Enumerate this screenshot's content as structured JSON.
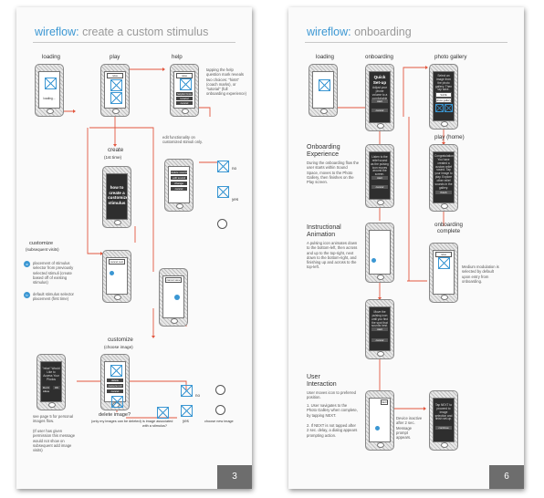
{
  "colors": {
    "title_prefix": "#3b97d3",
    "flow_line": "#e2573f",
    "page_number_bg": "#6d6d6d",
    "accent_blue": "#3b97d3"
  },
  "left": {
    "title_prefix": "wireflow:",
    "title_main": " create a custom stimulus",
    "page_number": "3",
    "labels": {
      "loading": "loading",
      "play": "play",
      "help": "help",
      "create": "create",
      "create_sub": "(1st time)",
      "customize": "customize",
      "customize_sub": "(subsequent visits)",
      "customize2": "customize",
      "customize2_sub": "(choose image)",
      "delete_image": "delete image?",
      "delete_image_sub": "(only my images can be deleted)",
      "image_associated": "is image associated",
      "image_associated2": "with a stimulus?",
      "no": "no",
      "yes": "yes",
      "no2": "no",
      "yes2": "yes",
      "choose_new_image": "choose new image"
    },
    "notes": {
      "help_note": "tapping the help question mark reveals two choices: \"hints\" (coach marks), or \"tutorial\" (full onboarding experience)",
      "edit_note": "edit functionality on customized stimuli only.",
      "placement_note": "placement of stimulus selector from previously selected stimuli (create based off of existing stimulus)",
      "default_note": "default stimulus selector placement (first time)",
      "see_page": "see page 5 for personal images flow.",
      "permission_note": "(If user has given permission this message would not show on subsequent add image visits)"
    },
    "screens": {
      "loading_text": "loading...",
      "play_top": "relax",
      "help_top": "relax",
      "help_menu": [
        "helpful hints",
        "tutorial",
        "cancel"
      ],
      "create_top": [
        "cancel",
        "save"
      ],
      "create_body": [
        "how to",
        "create a",
        "customized",
        "stimulus"
      ],
      "edit_menu": [
        "delete sound",
        "edit sound",
        "change image",
        "cancel"
      ],
      "customize_top": [
        "cancel",
        "next"
      ],
      "customize_top2": [
        "cancel",
        "save"
      ],
      "perm_body": "\"relax\" Would Like to Access Your Photos",
      "perm_buttons": [
        "Don't Allow",
        "OK"
      ],
      "img_menu": [
        "delete",
        "camera roll",
        "cancel"
      ]
    }
  },
  "right": {
    "title_prefix": "wireflow:",
    "title_main": " onboarding",
    "page_number": "6",
    "labels": {
      "loading": "loading",
      "onboarding": "onboarding",
      "photo_gallery": "photo gallery",
      "play_home": "play (home)",
      "onboarding_complete": "onboarding",
      "onboarding_complete2": "complete"
    },
    "sections": {
      "onboarding_exp_title": [
        "Onboarding",
        "Experience"
      ],
      "onboarding_exp_body": "During the onboarding flow the user starts within Sound Space, moves to the Photo Gallery, then finishes on the Play screen.",
      "anim_title": [
        "Instructional",
        "Animation"
      ],
      "anim_body": "A pulsing icon animates down to the bottom-left, then across and up to the top-right, next down to the bottom-right, and finishing up and across to the top-left.",
      "ui_title": [
        "User",
        "Interaction"
      ],
      "ui_body": "User moves icon to preferred position.",
      "ui_list": [
        "1. User navigates to the Photo Gallery when complete, by tapping NEXT.",
        "2. If NEXT is not tapped after 2 sec. delay, a dialog appears prompting action."
      ],
      "medium_mod": "Medium modulation is selected by default upon entry from onboarding.",
      "device_inactive": "Device inactive after 2 sec. Message prompt appears."
    },
    "screens": {
      "quick_setup": [
        "Quick",
        "Set-up"
      ],
      "quick_body": "Adjust your phone volume to a comfortable level.",
      "start": "start",
      "cancel": "cancel",
      "listen_body": "Listen to the relief sound as the pulsing icon moves around the screen.",
      "move_body": "Move the pulsing icon until you find the spot that sounds best.",
      "next": "NEXT",
      "gallery_body": "Select an image from the photo gallery. Then tap save.",
      "save": "SAVE",
      "photo_gallery_bar": "photo gallery",
      "congrats_body": "Congratulations! You have created a custom relief sound. Tap your image to play. Explore other relief sounds in the gallery.",
      "finish": "finish",
      "relax": "relax",
      "tap_next": "Tap NEXT to proceed to image selection and finish set-up.",
      "continue": "continue"
    }
  }
}
